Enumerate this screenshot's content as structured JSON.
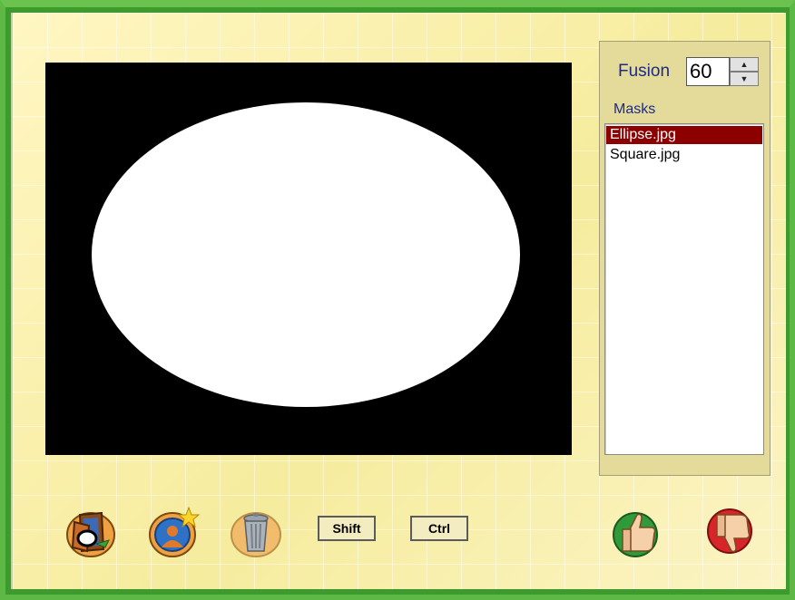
{
  "fusion": {
    "label": "Fusion",
    "value": "60"
  },
  "masks": {
    "label": "Masks",
    "items": [
      {
        "label": "Ellipse.jpg",
        "selected": true
      },
      {
        "label": "Square.jpg",
        "selected": false
      }
    ]
  },
  "toolbar": {
    "open_icon": "open-door-icon",
    "new_icon": "new-profile-star-icon",
    "delete_icon": "trash-can-icon",
    "shift_label": "Shift",
    "ctrl_label": "Ctrl",
    "accept_icon": "thumbs-up-icon",
    "reject_icon": "thumbs-down-icon"
  },
  "colors": {
    "frame_green": "#4fa637",
    "background_yellow": "#fbf3b8",
    "label_blue": "#1e2a86",
    "selection_red": "#8c0000"
  }
}
